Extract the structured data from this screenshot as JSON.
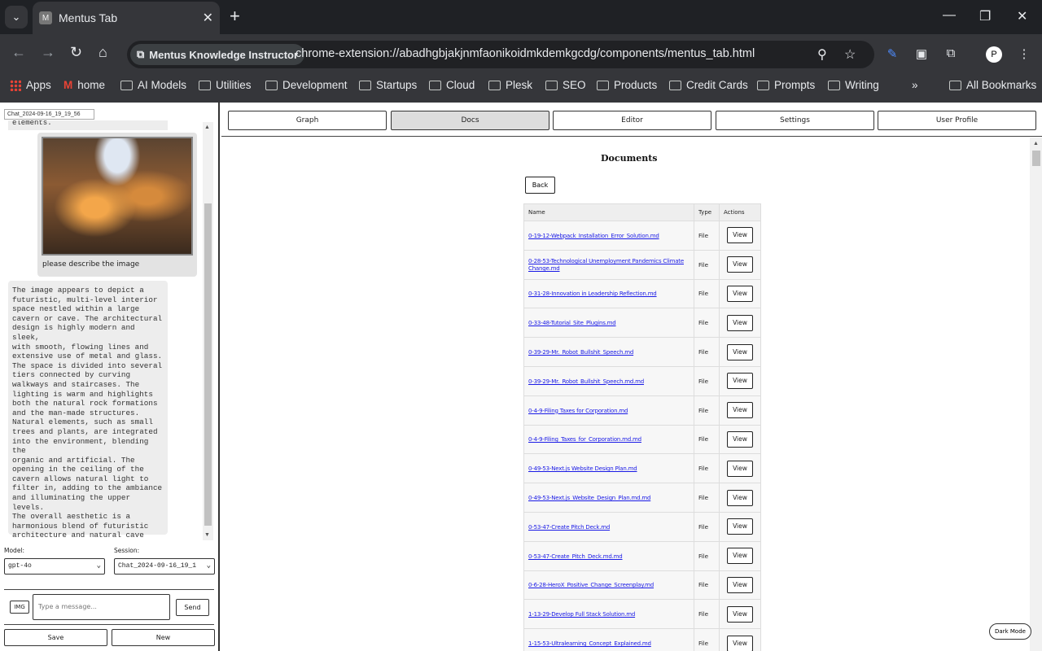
{
  "browser": {
    "tab_title": "Mentus Tab",
    "favicon_letter": "M",
    "site_chip": "Mentus Knowledge Instructor",
    "url": "chrome-extension://abadhgbjakjnmfaonikoidmkdemkgcdg/components/mentus_tab.html",
    "bookmarks": [
      "Apps",
      "home",
      "AI Models",
      "Utilities",
      "Development",
      "Startups",
      "Cloud",
      "Plesk",
      "SEO",
      "Products",
      "Credit Cards",
      "Prompts",
      "Writing"
    ],
    "more_bookmarks": "»",
    "all_bookmarks": "All Bookmarks"
  },
  "left": {
    "chat_id": "Chat_2024-09-16_19_19_56",
    "prev_fragment": "elements.",
    "user_message": "please describe the image",
    "assistant_message": "The image appears to depict a\nfuturistic, multi-level interior\nspace nestled within a large\ncavern or cave. The architectural\ndesign is highly modern and sleek,\nwith smooth, flowing lines and\nextensive use of metal and glass.\nThe space is divided into several\ntiers connected by curving\nwalkways and staircases. The\nlighting is warm and highlights\nboth the natural rock formations\nand the man-made structures.\nNatural elements, such as small\ntrees and plants, are integrated\ninto the environment, blending the\norganic and artificial. The\nopening in the ceiling of the\ncavern allows natural light to\nfilter in, adding to the ambiance\nand illuminating the upper levels.\nThe overall aesthetic is a\nharmonious blend of futuristic\narchitecture and natural cave\nelements, creating a serene and\nsophisticated atmosphere.",
    "model_label": "Model:",
    "model_value": "gpt-4o",
    "session_label": "Session:",
    "session_value": "Chat_2024-09-16_19_1",
    "img_button": "IMG",
    "message_placeholder": "Type a message...",
    "send_button": "Send",
    "save_button": "Save",
    "new_button": "New"
  },
  "tabs": [
    "Graph",
    "Docs",
    "Editor",
    "Settings",
    "User Profile"
  ],
  "active_tab": "Docs",
  "docs": {
    "title": "Documents",
    "back_button": "Back",
    "columns": [
      "Name",
      "Type",
      "Actions"
    ],
    "view_label": "View",
    "rows": [
      {
        "name": "0-19-12-Webpack_Installation_Error_Solution.md",
        "type": "File"
      },
      {
        "name": "0-28-53-Technological Unemployment Pandemics Climate Change.md",
        "type": "File"
      },
      {
        "name": "0-31-28-Innovation in Leadership Reflection.md",
        "type": "File"
      },
      {
        "name": "0-33-48-Tutorial_Site_Plugins.md",
        "type": "File"
      },
      {
        "name": "0-39-29-Mr._Robot_Bullshit_Speech.md",
        "type": "File"
      },
      {
        "name": "0-39-29-Mr._Robot_Bullshit_Speech.md.md",
        "type": "File"
      },
      {
        "name": "0-4-9-Filing Taxes for Corporation.md",
        "type": "File"
      },
      {
        "name": "0-4-9-Filing_Taxes_for_Corporation.md.md",
        "type": "File"
      },
      {
        "name": "0-49-53-Next.js Website Design Plan.md",
        "type": "File"
      },
      {
        "name": "0-49-53-Next.js_Website_Design_Plan.md.md",
        "type": "File"
      },
      {
        "name": "0-53-47-Create Pitch Deck.md",
        "type": "File"
      },
      {
        "name": "0-53-47-Create_Pitch_Deck.md.md",
        "type": "File"
      },
      {
        "name": "0-6-28-HeroX_Positive_Change_Screenplay.md",
        "type": "File"
      },
      {
        "name": "1-13-29-Develop Full Stack Solution.md",
        "type": "File"
      },
      {
        "name": "1-15-53-Ultralearning_Concept_Explained.md",
        "type": "File"
      }
    ]
  },
  "dark_mode_button": "Dark Mode"
}
